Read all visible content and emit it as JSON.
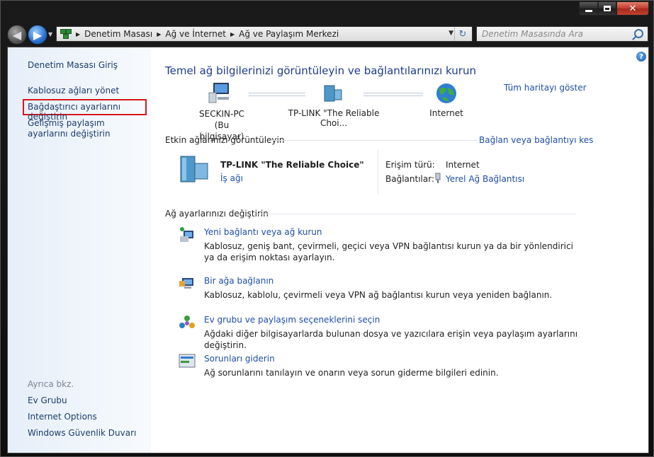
{
  "window": {
    "caption_buttons": {
      "minimize": "minimize",
      "maximize": "maximize",
      "close": "✕"
    }
  },
  "address_bar": {
    "crumbs": [
      "Denetim Masası",
      "Ağ ve İnternet",
      "Ağ ve Paylaşım Merkezi"
    ]
  },
  "search": {
    "placeholder": "Denetim Masasında Ara"
  },
  "sidebar": {
    "home": "Denetim Masası Giriş",
    "items": [
      "Kablosuz ağları yönet",
      "Bağdaştırıcı ayarlarını değiştirin",
      "Gelişmiş paylaşım ayarlarını değiştirin"
    ],
    "see_also_heading": "Ayrıca bkz.",
    "see_also": [
      "Ev Grubu",
      "Internet Options",
      "Windows Güvenlik Duvarı"
    ]
  },
  "main": {
    "title": "Temel ağ bilgilerinizi görüntüleyin ve bağlantılarınızı kurun",
    "full_map_link": "Tüm haritayı göster",
    "map_nodes": [
      {
        "name": "SECKIN-PC",
        "sub": "(Bu bilgisayar)"
      },
      {
        "name": "TP-LINK \"The Reliable Choi...",
        "sub": ""
      },
      {
        "name": "Internet",
        "sub": ""
      }
    ],
    "active_heading": "Etkin ağlarınızı görüntüleyin",
    "connect_link": "Bağlan veya bağlantıyı kes",
    "network": {
      "name": "TP-LINK \"The Reliable Choice\"",
      "type": "İş ağı",
      "access_label": "Erişim türü:",
      "access_value": "Internet",
      "connections_label": "Bağlantılar:",
      "connections_value": "Yerel Ağ Bağlantısı"
    },
    "change_heading": "Ağ ayarlarınızı değiştirin",
    "tasks": [
      {
        "title": "Yeni bağlantı veya ağ kurun",
        "desc": "Kablosuz, geniş bant, çevirmeli, geçici veya VPN bağlantısı kurun ya da bir yönlendirici ya da erişim noktası ayarlayın.",
        "icon": "new-connection-icon"
      },
      {
        "title": "Bir ağa bağlanın",
        "desc": "Kablosuz, kablolu, çevirmeli veya VPN ağ bağlantısı kurun veya yeniden bağlanın.",
        "icon": "connect-network-icon"
      },
      {
        "title": "Ev grubu ve paylaşım seçeneklerini seçin",
        "desc": "Ağdaki diğer bilgisayarlarda bulunan dosya ve yazıcılara erişin veya paylaşım ayarlarını değiştirin.",
        "icon": "homegroup-icon"
      },
      {
        "title": "Sorunları giderin",
        "desc": "Ağ sorunlarını tanılayın ve onarın veya sorun giderme bilgileri edinin.",
        "icon": "troubleshoot-icon"
      }
    ]
  },
  "help": "?"
}
